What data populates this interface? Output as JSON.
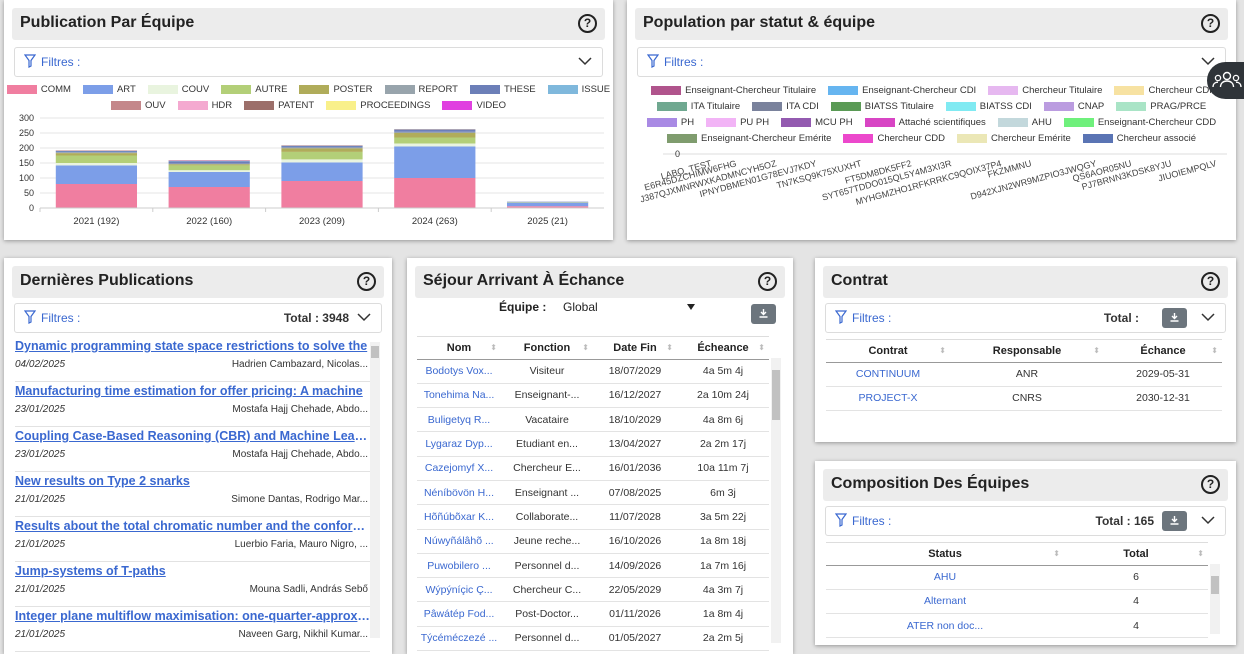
{
  "publication": {
    "title": "Publication Par Équipe",
    "filter_label": "Filtres :",
    "legend": [
      [
        [
          "COMM",
          "#f07ea0"
        ],
        [
          "ART",
          "#7c9ee8"
        ],
        [
          "COUV",
          "#e9f4df"
        ],
        [
          "AUTRE",
          "#b3cf78"
        ],
        [
          "POSTER",
          "#b0ac5a"
        ],
        [
          "REPORT",
          "#98a4ac"
        ],
        [
          "THESE",
          "#6c7fb8"
        ],
        [
          "ISSUE",
          "#7fb8dc"
        ]
      ],
      [
        [
          "OUV",
          "#c4878a"
        ],
        [
          "HDR",
          "#f4a9d0"
        ],
        [
          "PATENT",
          "#9c6f6a"
        ],
        [
          "PROCEEDINGS",
          "#f9f08a"
        ],
        [
          "VIDEO",
          "#e040e0"
        ]
      ]
    ]
  },
  "chart_data": {
    "type": "bar",
    "stacked": true,
    "categories": [
      "2021 (192)",
      "2022 (160)",
      "2023 (209)",
      "2024 (263)",
      "2025 (21)"
    ],
    "ylim": [
      0,
      300
    ],
    "yticks": [
      0,
      50,
      100,
      150,
      200,
      250,
      300
    ],
    "series": [
      {
        "name": "COMM",
        "color": "#f07ea0",
        "values": [
          80,
          70,
          90,
          100,
          6
        ]
      },
      {
        "name": "ART",
        "color": "#7c9ee8",
        "values": [
          62,
          50,
          62,
          105,
          12
        ]
      },
      {
        "name": "COUV",
        "color": "#e9f4df",
        "values": [
          8,
          6,
          10,
          10,
          1
        ]
      },
      {
        "name": "AUTRE",
        "color": "#b3cf78",
        "values": [
          25,
          16,
          25,
          20,
          1
        ]
      },
      {
        "name": "POSTER",
        "color": "#b0ac5a",
        "values": [
          8,
          4,
          12,
          15,
          0
        ]
      },
      {
        "name": "REPORT",
        "color": "#98a4ac",
        "values": [
          3,
          2,
          3,
          4,
          0
        ]
      },
      {
        "name": "THESE",
        "color": "#6c7fb8",
        "values": [
          4,
          8,
          5,
          6,
          1
        ]
      },
      {
        "name": "ISSUE",
        "color": "#7fb8dc",
        "values": [
          1,
          2,
          1,
          2,
          0
        ]
      },
      {
        "name": "OUV",
        "color": "#c4878a",
        "values": [
          1,
          1,
          1,
          1,
          0
        ]
      },
      {
        "name": "HDR",
        "color": "#f4a9d0",
        "values": [
          0,
          1,
          0,
          0,
          0
        ]
      },
      {
        "name": "PATENT",
        "color": "#9c6f6a",
        "values": [
          0,
          0,
          0,
          0,
          0
        ]
      },
      {
        "name": "PROCEEDINGS",
        "color": "#f9f08a",
        "values": [
          0,
          0,
          0,
          0,
          0
        ]
      },
      {
        "name": "VIDEO",
        "color": "#e040e0",
        "values": [
          0,
          0,
          0,
          0,
          0
        ]
      }
    ]
  },
  "population": {
    "title": "Population par statut & équipe",
    "filter_label": "Filtres :",
    "legend": [
      [
        [
          "Enseignant-Chercheur Titulaire",
          "#b0548c"
        ],
        [
          "Enseignant-Chercheur CDI",
          "#66b5f0"
        ],
        [
          "Chercheur Titulaire",
          "#e6b8f0"
        ],
        [
          "Chercheur CDI",
          "#f7e2a2"
        ]
      ],
      [
        [
          "ITA Titulaire",
          "#6fa890"
        ],
        [
          "ITA CDI",
          "#7a829c"
        ],
        [
          "BIATSS Titulaire",
          "#5a9a55"
        ],
        [
          "BIATSS CDI",
          "#80eaf2"
        ],
        [
          "CNAP",
          "#bb9ce0"
        ],
        [
          "PRAG/PRCE",
          "#a9e4c6"
        ]
      ],
      [
        [
          "PH",
          "#a98ae4"
        ],
        [
          "PU PH",
          "#f2b4f6"
        ],
        [
          "MCU PH",
          "#935ab0"
        ],
        [
          "Attaché scientifiques",
          "#d845c4"
        ],
        [
          "AHU",
          "#c3d8dc"
        ],
        [
          "Enseignant-Chercheur CDD",
          "#6ff07c"
        ]
      ],
      [
        [
          "Enseignant-Chercheur Emérite",
          "#7f9c6e"
        ],
        [
          "Chercheur CDD",
          "#ec48cc"
        ],
        [
          "Chercheur Emérite",
          "#ebe7b6"
        ],
        [
          "Chercheur associé",
          "#5a74b4"
        ]
      ]
    ],
    "zero_label": "0",
    "team_labels": [
      "LABO_TEST",
      "E6R45DZCHIMW6FHG",
      "J387QJXMNRWXKADMNCYH5OZ",
      "IPNYDBMEN01G78EVJ7KDY",
      "TN7KSQ9K75XUXHT",
      "FT5DM8DK5FF2",
      "SYT657TDDO015QL5Y4M3XI3R",
      "MYHGMZHO1RFKRRKC9QOIX37P4",
      "FKZMMNU",
      "D942XJN2WR9MZPIO3JWQGY",
      "QS6AOR05NU",
      "PJ7BRNN3KDSK8YJU",
      "JIUOIEMPQLV"
    ]
  },
  "publications": {
    "title": "Dernières Publications",
    "filter_label": "Filtres :",
    "total": "Total : 3948",
    "items": [
      {
        "title": "Dynamic programming state space restrictions to solve the",
        "date": "04/02/2025",
        "authors": "Hadrien Cambazard, Nicolas..."
      },
      {
        "title": "Manufacturing time estimation for offer pricing: A machine",
        "date": "23/01/2025",
        "authors": "Mostafa Hajj Chehade, Abdo..."
      },
      {
        "title": "Coupling Case-Based Reasoning (CBR) and Machine Learning",
        "date": "23/01/2025",
        "authors": "Mostafa Hajj Chehade, Abdo..."
      },
      {
        "title": "New results on Type 2 snarks",
        "date": "21/01/2025",
        "authors": "Simone Dantas, Rodrigo Mar..."
      },
      {
        "title": "Results about the total chromatic number and the conformability",
        "date": "21/01/2025",
        "authors": "Luerbio Faria, Mauro Nigro, ..."
      },
      {
        "title": "Jump-systems of T-paths",
        "date": "21/01/2025",
        "authors": "Mouna Sadli, András Sebő"
      },
      {
        "title": "Integer plane multiflow maximisation: one-quarter-approximation",
        "date": "21/01/2025",
        "authors": "Naveen Garg, Nikhil Kumar..."
      }
    ]
  },
  "sejour": {
    "title": "Séjour Arrivant À Échance",
    "equipe_label": "Équipe :",
    "equipe_value": "Global",
    "columns": [
      "Nom",
      "Fonction",
      "Date Fin",
      "Écheance"
    ],
    "rows": [
      [
        "Bodotys Vox...",
        "Visiteur",
        "18/07/2029",
        "4a 5m 4j"
      ],
      [
        "Tonehima Na...",
        "Enseignant-...",
        "16/12/2027",
        "2a 10m 24j"
      ],
      [
        "Buligetyq R...",
        "Vacataire",
        "18/10/2029",
        "4a 8m 6j"
      ],
      [
        "Lygaraz Dyp...",
        "Etudiant en...",
        "13/04/2027",
        "2a 2m 17j"
      ],
      [
        "Cazejomyf X...",
        "Chercheur E...",
        "16/01/2036",
        "10a 11m 7j"
      ],
      [
        "Néníbövön H...",
        "Enseignant ...",
        "07/08/2025",
        "6m 3j"
      ],
      [
        "Hõñúbõxar K...",
        "Collaborate...",
        "11/07/2028",
        "3a 5m 22j"
      ],
      [
        "Núwyñálâhõ ...",
        "Jeune reche...",
        "16/10/2026",
        "1a 8m 18j"
      ],
      [
        "Puwobilero ...",
        "Personnel d...",
        "14/09/2026",
        "1a 7m 16j"
      ],
      [
        "Wýpýníçic Ç...",
        "Chercheur C...",
        "22/05/2029",
        "4a 3m 7j"
      ],
      [
        "Pâwátép Fod...",
        "Post-Doctor...",
        "01/11/2026",
        "1a 8m 4j"
      ],
      [
        "Týcéméczezé ...",
        "Personnel d...",
        "01/05/2027",
        "2a 2m 5j"
      ]
    ]
  },
  "contrat": {
    "title": "Contrat",
    "filter_label": "Filtres :",
    "total": "Total :",
    "columns": [
      "Contrat",
      "Responsable",
      "Échance"
    ],
    "rows": [
      [
        "CONTINUUM",
        "ANR",
        "2029-05-31"
      ],
      [
        "PROJECT-X",
        "CNRS",
        "2030-12-31"
      ]
    ]
  },
  "composition": {
    "title": "Composition Des Équipes",
    "filter_label": "Filtres :",
    "total": "Total : 165",
    "columns": [
      "Status",
      "Total"
    ],
    "rows": [
      [
        "AHU",
        "6"
      ],
      [
        "Alternant",
        "4"
      ],
      [
        "ATER non doc...",
        "4"
      ]
    ]
  },
  "help_glyph": "?"
}
